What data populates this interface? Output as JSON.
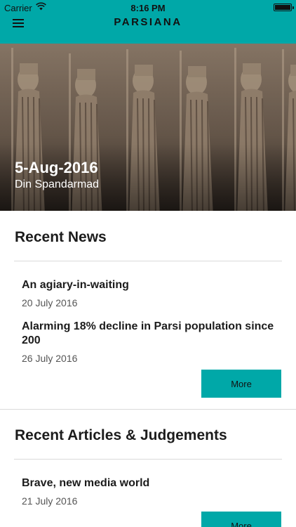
{
  "status_bar": {
    "carrier": "Carrier",
    "time": "8:16 PM"
  },
  "nav": {
    "title": "PARSIANA",
    "menu_icon": "hamburger-menu-icon"
  },
  "hero": {
    "date": "5-Aug-2016",
    "subtitle": "Din Spandarmad"
  },
  "recent_news": {
    "heading": "Recent News",
    "items": [
      {
        "title": "An agiary-in-waiting",
        "date": "20 July 2016"
      },
      {
        "title": "Alarming 18% decline in Parsi population since 200",
        "date": "26 July 2016"
      }
    ],
    "more_label": "More"
  },
  "recent_articles": {
    "heading": "Recent Articles & Judgements",
    "items": [
      {
        "title": "Brave, new media world",
        "date": "21 July 2016"
      }
    ],
    "more_label": "More"
  },
  "colors": {
    "accent": "#00a8a8",
    "text": "#1c1c1c",
    "divider": "#dadada"
  }
}
